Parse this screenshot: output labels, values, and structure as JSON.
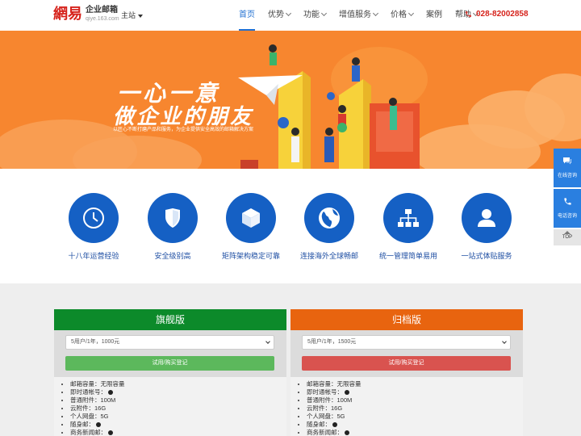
{
  "header": {
    "logo_mark": "網易",
    "logo_name": "企业邮箱",
    "logo_url": "qiye.163.com",
    "site_switch": "主站",
    "phone": "028-82002858"
  },
  "nav": [
    {
      "label": "首页",
      "active": true,
      "dropdown": false
    },
    {
      "label": "优势",
      "active": false,
      "dropdown": true
    },
    {
      "label": "功能",
      "active": false,
      "dropdown": true
    },
    {
      "label": "增值服务",
      "active": false,
      "dropdown": true
    },
    {
      "label": "价格",
      "active": false,
      "dropdown": true
    },
    {
      "label": "案例",
      "active": false,
      "dropdown": false
    },
    {
      "label": "帮助",
      "active": false,
      "dropdown": true
    }
  ],
  "banner": {
    "title1": "一心一意",
    "title2": "做企业的朋友",
    "subtitle": "以匠心不断打磨产品和服务，为企业提供安全高效的邮箱解决方案"
  },
  "features": [
    {
      "label": "十八年运营经验",
      "icon": "clock-icon"
    },
    {
      "label": "安全级别高",
      "icon": "shield-icon"
    },
    {
      "label": "矩阵架构稳定可靠",
      "icon": "cube-icon"
    },
    {
      "label": "连接海外全球畅邮",
      "icon": "globe-icon"
    },
    {
      "label": "统一管理简单易用",
      "icon": "org-chart-icon"
    },
    {
      "label": "一站式体贴服务",
      "icon": "user-icon"
    }
  ],
  "plans": [
    {
      "name": "旗舰版",
      "color": "#0c8a2a",
      "button_color": "#5cb85c",
      "select_value": "5用户/1年，1000元",
      "button_label": "试用/购买登记",
      "features": [
        "邮箱容量：无限容量",
        "即时通帐号：",
        "普通附件：100M",
        "云附件：16G",
        "个人网盘：5G",
        "随身邮：",
        "商务新闻邮："
      ]
    },
    {
      "name": "归档版",
      "color": "#e8640f",
      "button_color": "#d9534f",
      "select_value": "5用户/1年，1500元",
      "button_label": "试用/购买登记",
      "features": [
        "邮箱容量：无限容量",
        "即时通帐号：",
        "普通附件：100M",
        "云附件：16G",
        "个人网盘：5G",
        "随身邮：",
        "商务新闻邮："
      ]
    }
  ],
  "side": {
    "consult": "在线咨询",
    "phone": "电话咨询",
    "top": "TOP"
  }
}
